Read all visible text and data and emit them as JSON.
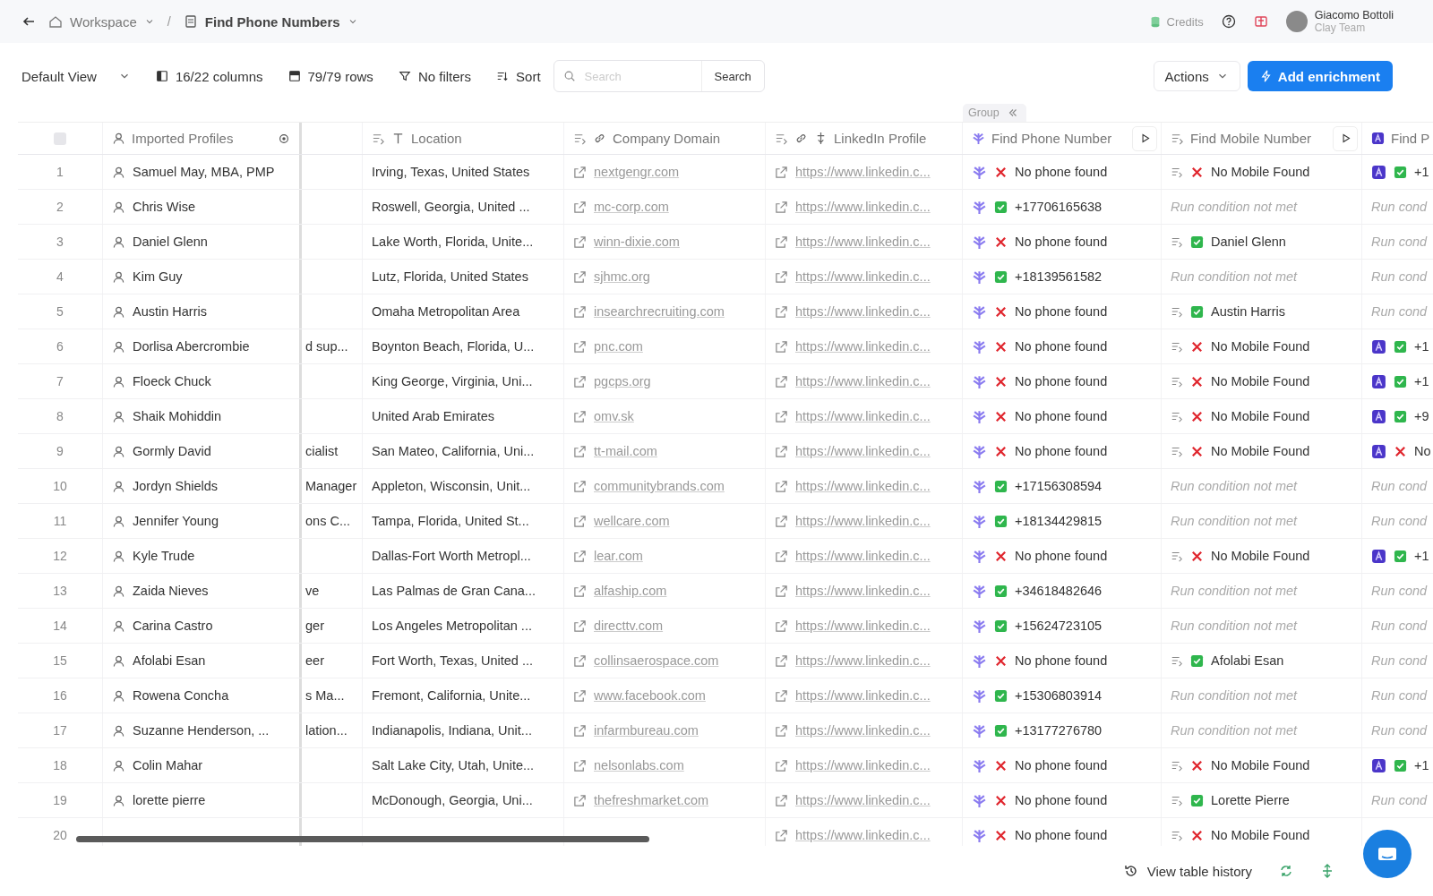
{
  "topbar": {
    "breadcrumbs": [
      {
        "kind": "workspace",
        "label": "Workspace"
      },
      {
        "kind": "table",
        "label": "Find Phone Numbers"
      }
    ],
    "separator": "/",
    "credits": "Credits",
    "user": {
      "name": "Giacomo Bottoli",
      "team": "Clay Team"
    }
  },
  "toolbar": {
    "view": "Default View",
    "columns": "16/22 columns",
    "rows": "79/79 rows",
    "filters": "No filters",
    "sort": "Sort",
    "search": {
      "placeholder": "Search",
      "button": "Search"
    },
    "actions": "Actions",
    "add_enrichment": "Add enrichment"
  },
  "table": {
    "group_label": "Group",
    "select_all_checked": false,
    "columns": [
      {
        "kind": "person",
        "label": "Imported Profiles"
      },
      {
        "kind": "blank"
      },
      {
        "kind": "text",
        "label": "Location"
      },
      {
        "kind": "link",
        "label": "Company Domain"
      },
      {
        "kind": "linkedin",
        "label": "LinkedIn Profile"
      },
      {
        "kind": "phone",
        "label": "Find Phone Number"
      },
      {
        "kind": "mobile",
        "label": "Find Mobile Number"
      },
      {
        "kind": "ai",
        "label": "Find P"
      }
    ],
    "rows": [
      {
        "num": "1",
        "name": "Samuel May, MBA, PMP",
        "location": "Irving, Texas, United States",
        "domain": "nextgengr.com",
        "linkedin": "https://www.linkedin.c...",
        "phone": {
          "ran": true,
          "found": false,
          "text": "No phone found"
        },
        "mobile": {
          "ran": true,
          "found": false,
          "text": "No Mobile Found"
        },
        "find_p": {
          "ran": true,
          "found": true,
          "text": "+1"
        }
      },
      {
        "num": "2",
        "name": "Chris Wise",
        "location": "Roswell, Georgia, United ...",
        "domain": "mc-corp.com",
        "linkedin": "https://www.linkedin.c...",
        "phone": {
          "ran": true,
          "found": true,
          "text": "+17706165638"
        },
        "mobile": {
          "ran": false,
          "text": "Run condition not met"
        },
        "find_p": {
          "ran": false,
          "text": "Run cond"
        }
      },
      {
        "num": "3",
        "name": "Daniel Glenn",
        "location": "Lake Worth, Florida, Unite...",
        "domain": "winn-dixie.com",
        "linkedin": "https://www.linkedin.c...",
        "phone": {
          "ran": true,
          "found": false,
          "text": "No phone found"
        },
        "mobile": {
          "ran": true,
          "found": true,
          "text": "Daniel Glenn"
        },
        "find_p": {
          "ran": false,
          "text": "Run cond"
        }
      },
      {
        "num": "4",
        "name": "Kim Guy",
        "location": "Lutz, Florida, United States",
        "domain": "sjhmc.org",
        "linkedin": "https://www.linkedin.c...",
        "phone": {
          "ran": true,
          "found": true,
          "text": "+18139561582"
        },
        "mobile": {
          "ran": false,
          "text": "Run condition not met"
        },
        "find_p": {
          "ran": false,
          "text": "Run cond"
        }
      },
      {
        "num": "5",
        "name": "Austin Harris",
        "location": "Omaha Metropolitan Area",
        "domain": "insearchrecruiting.com",
        "linkedin": "https://www.linkedin.c...",
        "phone": {
          "ran": true,
          "found": false,
          "text": "No phone found"
        },
        "mobile": {
          "ran": true,
          "found": true,
          "text": "Austin Harris"
        },
        "find_p": {
          "ran": false,
          "text": "Run cond"
        }
      },
      {
        "num": "6",
        "name": "Dorlisa Abercrombie",
        "column_3": "d sup...",
        "location": "Boynton Beach, Florida, U...",
        "domain": "pnc.com",
        "linkedin": "https://www.linkedin.c...",
        "phone": {
          "ran": true,
          "found": false,
          "text": "No phone found"
        },
        "mobile": {
          "ran": true,
          "found": false,
          "text": "No Mobile Found"
        },
        "find_p": {
          "ran": true,
          "found": true,
          "text": "+1"
        }
      },
      {
        "num": "7",
        "name": "Floeck Chuck",
        "location": "King George, Virginia, Uni...",
        "domain": "pgcps.org",
        "linkedin": "https://www.linkedin.c...",
        "phone": {
          "ran": true,
          "found": false,
          "text": "No phone found"
        },
        "mobile": {
          "ran": true,
          "found": false,
          "text": "No Mobile Found"
        },
        "find_p": {
          "ran": true,
          "found": true,
          "text": "+1"
        }
      },
      {
        "num": "8",
        "name": "Shaik Mohiddin",
        "location": "United Arab Emirates",
        "domain": "omv.sk",
        "linkedin": "https://www.linkedin.c...",
        "phone": {
          "ran": true,
          "found": false,
          "text": "No phone found"
        },
        "mobile": {
          "ran": true,
          "found": false,
          "text": "No Mobile Found"
        },
        "find_p": {
          "ran": true,
          "found": true,
          "text": "+9"
        }
      },
      {
        "num": "9",
        "name": "Gormly David",
        "column_3": "cialist",
        "location": "San Mateo, California, Uni...",
        "domain": "tt-mail.com",
        "linkedin": "https://www.linkedin.c...",
        "phone": {
          "ran": true,
          "found": false,
          "text": "No phone found"
        },
        "mobile": {
          "ran": true,
          "found": false,
          "text": "No Mobile Found"
        },
        "find_p": {
          "ran": true,
          "found": false,
          "text": "No"
        }
      },
      {
        "num": "10",
        "name": "Jordyn Shields",
        "column_3": "Manager",
        "location": "Appleton, Wisconsin, Unit...",
        "domain": "communitybrands.com",
        "linkedin": "https://www.linkedin.c...",
        "phone": {
          "ran": true,
          "found": true,
          "text": "+17156308594"
        },
        "mobile": {
          "ran": false,
          "text": "Run condition not met"
        },
        "find_p": {
          "ran": false,
          "text": "Run cond"
        }
      },
      {
        "num": "11",
        "name": "Jennifer Young",
        "column_3": "ons C...",
        "location": "Tampa, Florida, United St...",
        "domain": "wellcare.com",
        "linkedin": "https://www.linkedin.c...",
        "phone": {
          "ran": true,
          "found": true,
          "text": "+18134429815"
        },
        "mobile": {
          "ran": false,
          "text": "Run condition not met"
        },
        "find_p": {
          "ran": false,
          "text": "Run cond"
        }
      },
      {
        "num": "12",
        "name": "Kyle Trude",
        "location": "Dallas-Fort Worth Metropl...",
        "domain": "lear.com",
        "linkedin": "https://www.linkedin.c...",
        "phone": {
          "ran": true,
          "found": false,
          "text": "No phone found"
        },
        "mobile": {
          "ran": true,
          "found": false,
          "text": "No Mobile Found"
        },
        "find_p": {
          "ran": true,
          "found": true,
          "text": "+1"
        }
      },
      {
        "num": "13",
        "name": "Zaida Nieves",
        "column_3": "ve",
        "location": "Las Palmas de Gran Cana...",
        "domain": "alfaship.com",
        "linkedin": "https://www.linkedin.c...",
        "phone": {
          "ran": true,
          "found": true,
          "text": "+34618482646"
        },
        "mobile": {
          "ran": false,
          "text": "Run condition not met"
        },
        "find_p": {
          "ran": false,
          "text": "Run cond"
        }
      },
      {
        "num": "14",
        "name": "Carina Castro",
        "column_3": "ger",
        "location": "Los Angeles Metropolitan ...",
        "domain": "directtv.com",
        "linkedin": "https://www.linkedin.c...",
        "phone": {
          "ran": true,
          "found": true,
          "text": "+15624723105"
        },
        "mobile": {
          "ran": false,
          "text": "Run condition not met"
        },
        "find_p": {
          "ran": false,
          "text": "Run cond"
        }
      },
      {
        "num": "15",
        "name": "Afolabi Esan",
        "column_3": "eer",
        "location": "Fort Worth, Texas, United ...",
        "domain": "collinsaerospace.com",
        "linkedin": "https://www.linkedin.c...",
        "phone": {
          "ran": true,
          "found": false,
          "text": "No phone found"
        },
        "mobile": {
          "ran": true,
          "found": true,
          "text": "Afolabi Esan"
        },
        "find_p": {
          "ran": false,
          "text": "Run cond"
        }
      },
      {
        "num": "16",
        "name": "Rowena Concha",
        "column_3": "s Ma...",
        "location": "Fremont, California, Unite...",
        "domain": "www.facebook.com",
        "linkedin": "https://www.linkedin.c...",
        "phone": {
          "ran": true,
          "found": true,
          "text": "+15306803914"
        },
        "mobile": {
          "ran": false,
          "text": "Run condition not met"
        },
        "find_p": {
          "ran": false,
          "text": "Run cond"
        }
      },
      {
        "num": "17",
        "name": "Suzanne Henderson, ...",
        "column_3": "lation...",
        "location": "Indianapolis, Indiana, Unit...",
        "domain": "infarmbureau.com",
        "linkedin": "https://www.linkedin.c...",
        "phone": {
          "ran": true,
          "found": true,
          "text": "+13177276780"
        },
        "mobile": {
          "ran": false,
          "text": "Run condition not met"
        },
        "find_p": {
          "ran": false,
          "text": "Run cond"
        }
      },
      {
        "num": "18",
        "name": "Colin Mahar",
        "location": "Salt Lake City, Utah, Unite...",
        "domain": "nelsonlabs.com",
        "linkedin": "https://www.linkedin.c...",
        "phone": {
          "ran": true,
          "found": false,
          "text": "No phone found"
        },
        "mobile": {
          "ran": true,
          "found": false,
          "text": "No Mobile Found"
        },
        "find_p": {
          "ran": true,
          "found": true,
          "text": "+1"
        }
      },
      {
        "num": "19",
        "name": "lorette pierre",
        "location": "McDonough, Georgia, Uni...",
        "domain": "thefreshmarket.com",
        "linkedin": "https://www.linkedin.c...",
        "phone": {
          "ran": true,
          "found": false,
          "text": "No phone found"
        },
        "mobile": {
          "ran": true,
          "found": true,
          "text": "Lorette Pierre"
        },
        "find_p": {
          "ran": false,
          "text": "Run cond"
        }
      },
      {
        "num": "20",
        "linkedin": "https://www.linkedin.c...",
        "phone": {
          "ran": true,
          "found": false,
          "text": "No phone found"
        },
        "mobile": {
          "ran": true,
          "found": false,
          "text": "No Mobile Found"
        }
      }
    ]
  },
  "footer": {
    "history": "View table history"
  }
}
